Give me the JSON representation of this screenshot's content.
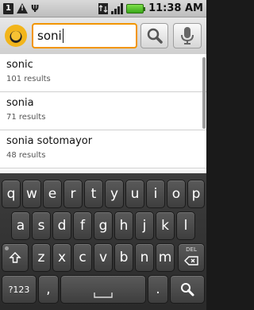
{
  "statusbar": {
    "notif_count": "1",
    "warning_glyph": "!",
    "usb_glyph": "Ψ",
    "time": "11:38 AM"
  },
  "search": {
    "query": "soni"
  },
  "suggestions": [
    {
      "term": "sonic",
      "count": "101 results"
    },
    {
      "term": "sonia",
      "count": "71 results"
    },
    {
      "term": "sonia sotomayor",
      "count": "48 results"
    }
  ],
  "keyboard": {
    "row1": [
      "q",
      "w",
      "e",
      "r",
      "t",
      "y",
      "u",
      "i",
      "o",
      "p"
    ],
    "row2": [
      "a",
      "s",
      "d",
      "f",
      "g",
      "h",
      "j",
      "k",
      "l"
    ],
    "row3": [
      "z",
      "x",
      "c",
      "v",
      "b",
      "n",
      "m"
    ],
    "symbols_label": "?123",
    "comma_label": ",",
    "period_label": ".",
    "delete_label": "DEL"
  }
}
